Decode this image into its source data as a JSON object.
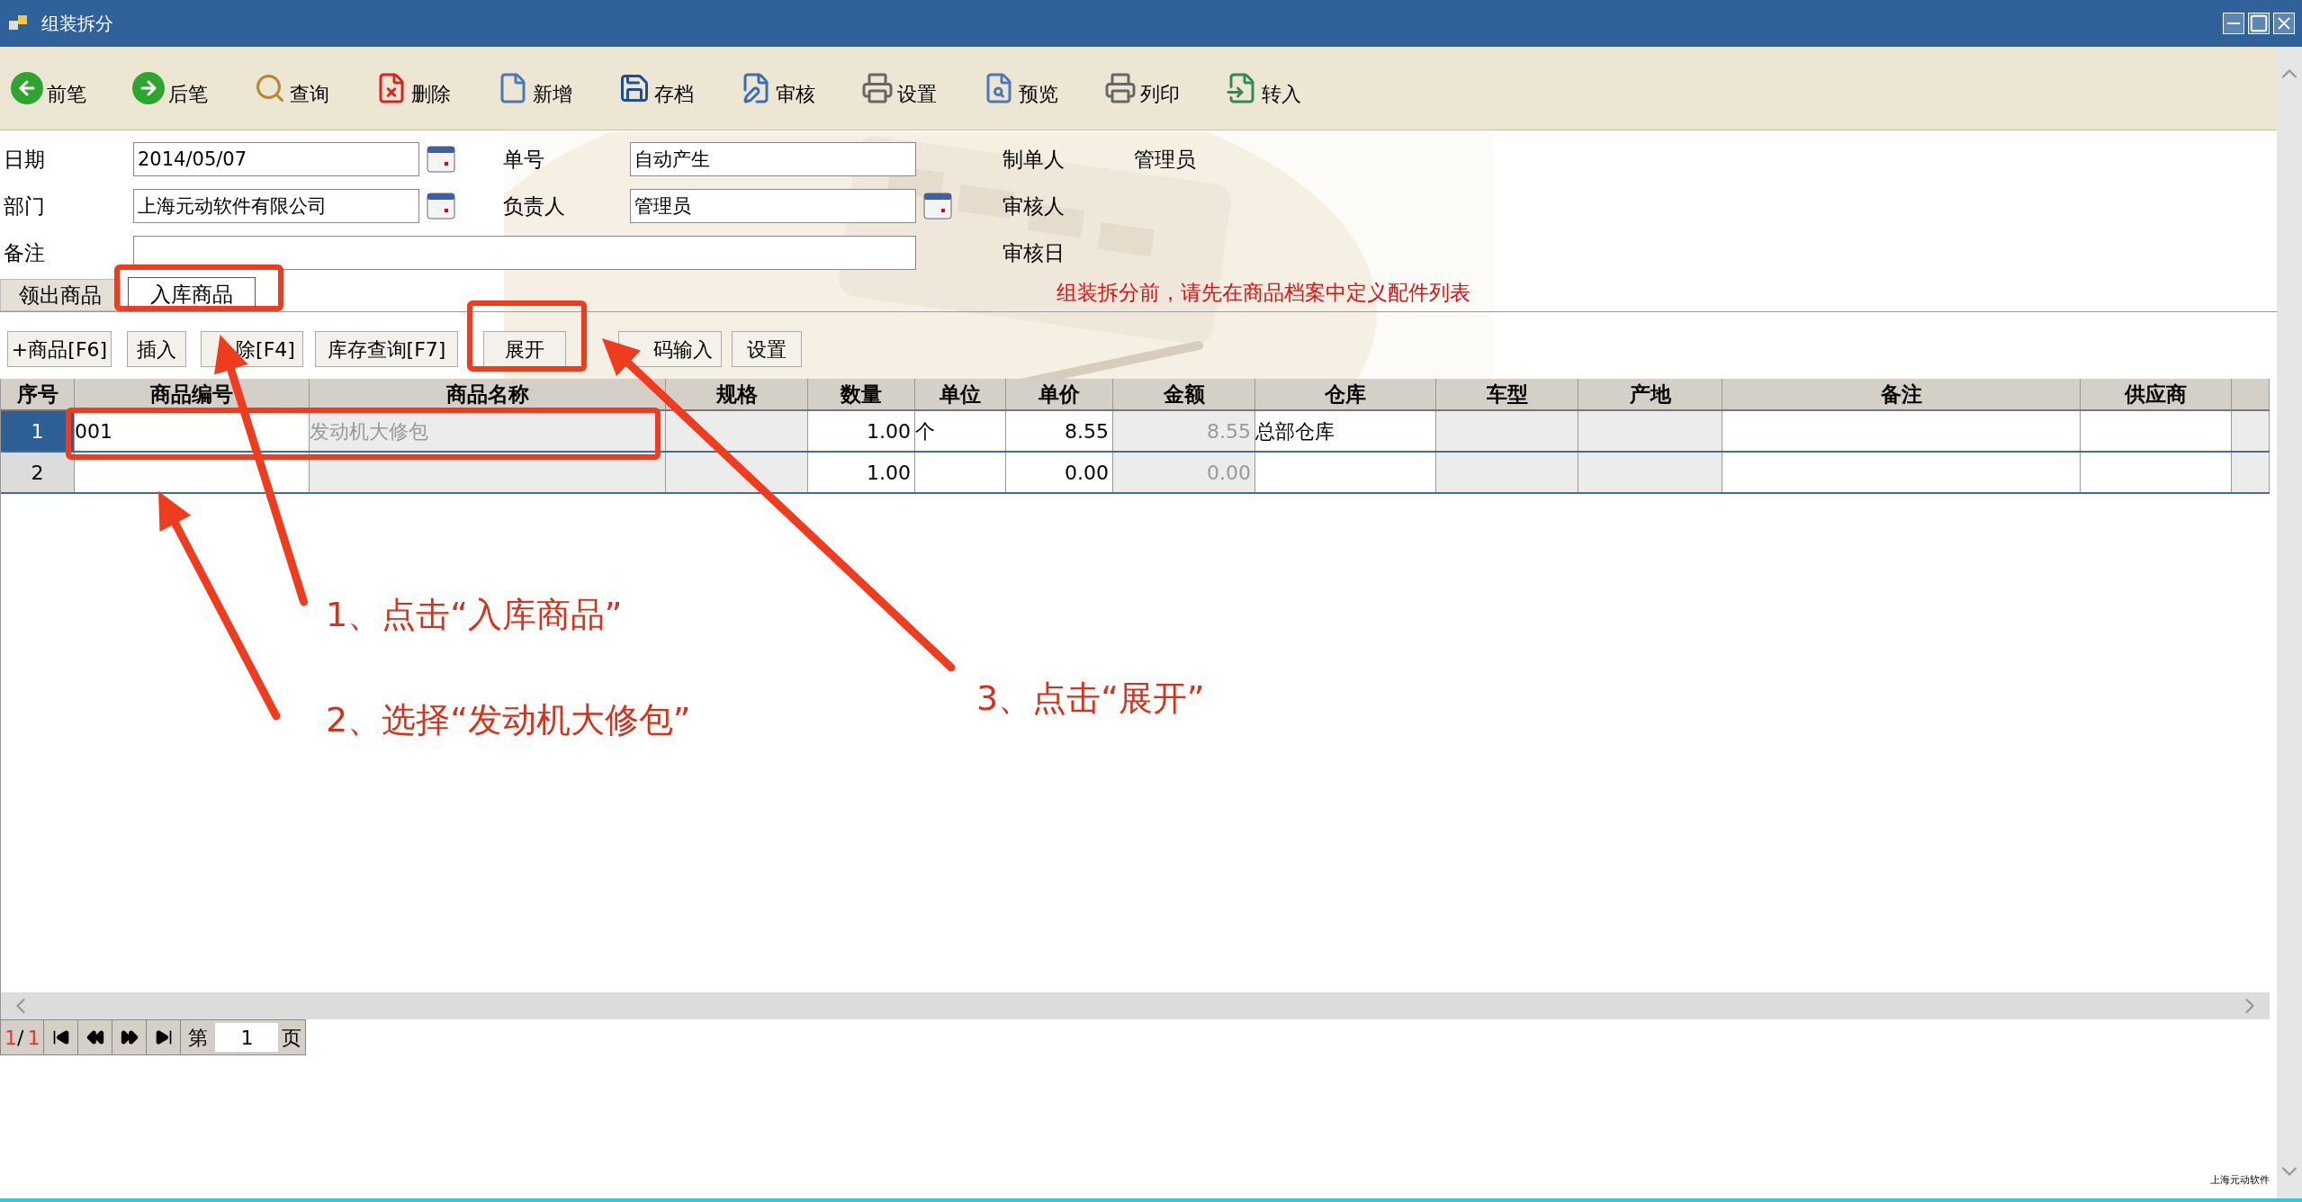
{
  "window": {
    "title": "组装拆分"
  },
  "toolbar": [
    {
      "label": "前笔"
    },
    {
      "label": "后笔"
    },
    {
      "label": "查询"
    },
    {
      "label": "删除"
    },
    {
      "label": "新增"
    },
    {
      "label": "存档"
    },
    {
      "label": "审核"
    },
    {
      "label": "设置"
    },
    {
      "label": "预览"
    },
    {
      "label": "列印"
    },
    {
      "label": "转入"
    }
  ],
  "form": {
    "fields": [
      {
        "label": "日期",
        "value": "2014/05/07",
        "calendar": true
      },
      {
        "label": "单号",
        "value": "自动产生",
        "calendar": false
      },
      {
        "label": "部门",
        "value": "上海元动软件有限公司",
        "calendar": true
      },
      {
        "label": "负责人",
        "value": "管理员",
        "calendar": true
      }
    ],
    "memo": {
      "label": "备注"
    },
    "audit": [
      {
        "label": "制单人",
        "value": "管理员"
      },
      {
        "label": "审核人"
      },
      {
        "label": "审核日"
      }
    ]
  },
  "tabs": [
    {
      "label": "领出商品",
      "selected": false
    },
    {
      "label": "入库商品",
      "selected": true
    }
  ],
  "notice": "组装拆分前，请先在商品档案中定义配件列表",
  "grid_buttons": [
    "+商品[F6]",
    "插入",
    "除[F4]",
    "库存查询[F7]",
    "展开",
    "码输入",
    "设置"
  ],
  "table": {
    "columns": [
      {
        "label": "序号"
      },
      {
        "label": "商品编号",
        "readonly": false
      },
      {
        "label": "商品名称",
        "readonly": true
      },
      {
        "label": "规格",
        "readonly": true
      },
      {
        "label": "数量",
        "readonly": false
      },
      {
        "label": "单位",
        "readonly": false
      },
      {
        "label": "单价",
        "readonly": false
      },
      {
        "label": "金额",
        "readonly": true
      },
      {
        "label": "仓库",
        "readonly": false
      },
      {
        "label": "车型",
        "readonly": true
      },
      {
        "label": "产地",
        "readonly": true
      },
      {
        "label": "备注",
        "readonly": false
      },
      {
        "label": "供应商",
        "readonly": false
      }
    ],
    "rows": [
      {
        "selected": true,
        "cells": [
          "1",
          "001",
          "发动机大修包",
          null,
          "1.00",
          "个",
          "8.55",
          "8.55",
          "总部仓库",
          null,
          null,
          null,
          null
        ]
      },
      {
        "selected": false,
        "cells": [
          "2",
          null,
          null,
          null,
          "1.00",
          null,
          "0.00",
          "0.00",
          null,
          null,
          null,
          null,
          null
        ]
      }
    ]
  },
  "pager": {
    "current": "1",
    "separator": "/",
    "total": "1",
    "prefix": "第",
    "page": "1",
    "suffix": "页"
  },
  "annotations": [
    "1、点击“入库商品”",
    "2、选择“发动机大修包”",
    "3、点击“展开”"
  ],
  "footer": "上海元动软件"
}
